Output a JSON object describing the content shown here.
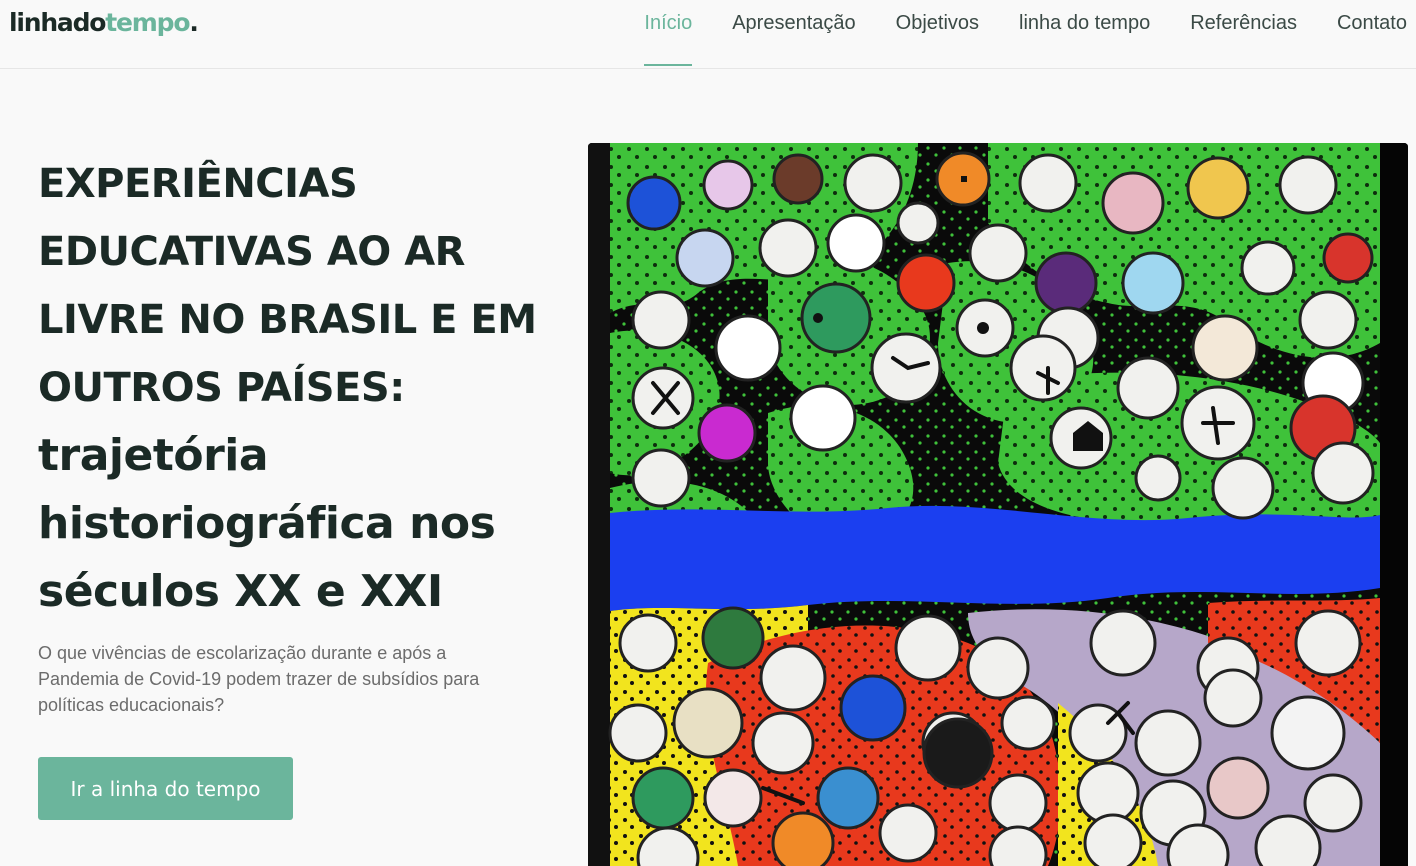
{
  "logo": {
    "part1": "linhado",
    "part2": "tempo",
    "part3": "."
  },
  "nav": {
    "items": [
      {
        "label": "Início",
        "active": true
      },
      {
        "label": "Apresentação",
        "active": false
      },
      {
        "label": "Objetivos",
        "active": false
      },
      {
        "label": "linha do tempo",
        "active": false
      },
      {
        "label": "Referências",
        "active": false
      },
      {
        "label": "Contato",
        "active": false
      }
    ]
  },
  "hero": {
    "title_upper_1": "EXPERIÊNCIAS",
    "title_upper_2": "EDUCATIVAS AO AR",
    "title_upper_3": "LIVRE NO BRASIL E EM",
    "title_upper_4": "OUTROS PAÍSES:",
    "title_lower_1": "trajetória",
    "title_lower_2": "historiográfica nos",
    "title_lower_3": "séculos XX e XXI",
    "subtitle": "O que vivências de escolarização durante e após a Pandemia de Covid-19 podem trazer de subsídios para políticas educacionais?",
    "cta_label": "Ir a linha do tempo"
  },
  "colors": {
    "accent": "#6bb59c",
    "heading": "#1b2a26",
    "body_text": "#6c6c6c",
    "art_green": "#3fc23a",
    "art_blue": "#1b3ff0",
    "art_red": "#e8391d",
    "art_yellow": "#f2e41e"
  },
  "art": {
    "subject": "painted-tree-artwork"
  }
}
